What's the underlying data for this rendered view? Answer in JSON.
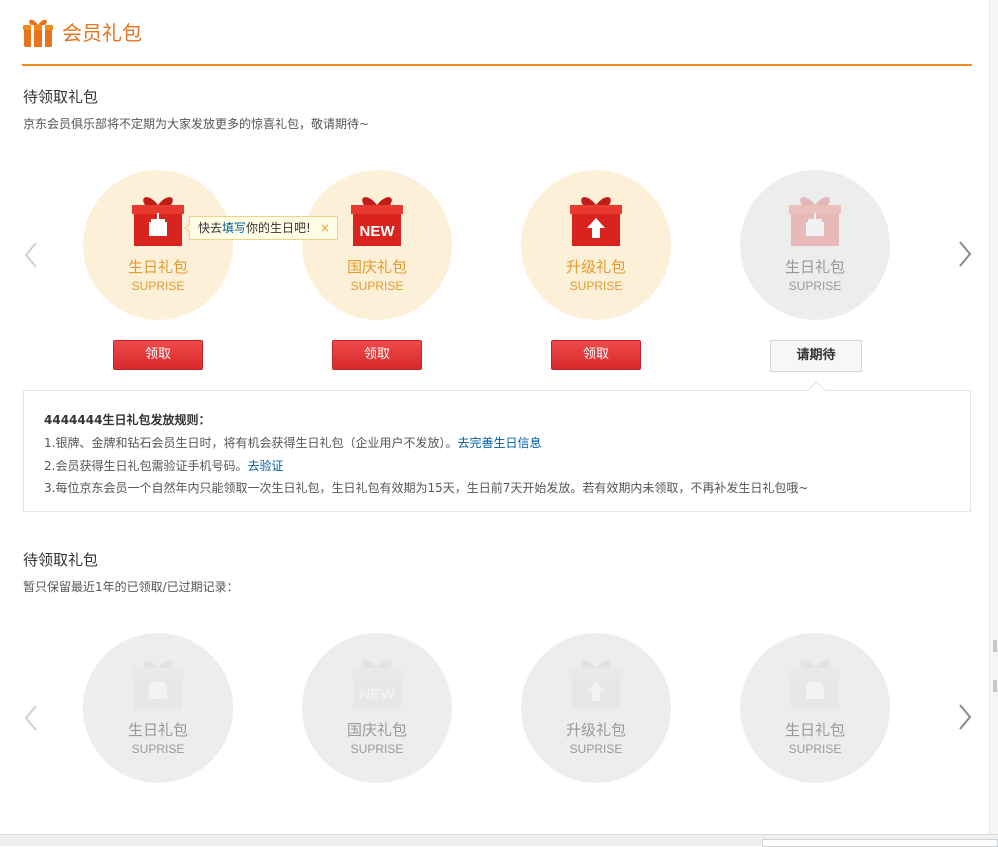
{
  "header": {
    "title": "会员礼包",
    "icon": "gift-icon"
  },
  "pending": {
    "title": "待领取礼包",
    "desc": "京东会员俱乐部将不定期为大家发放更多的惊喜礼包，敬请期待~",
    "items": [
      {
        "name": "生日礼包",
        "sub": "SUPRISE",
        "icon": "birthday-cake-gift-icon",
        "button": "领取"
      },
      {
        "name": "国庆礼包",
        "sub": "SUPRISE",
        "icon": "new-gift-icon",
        "button": "领取"
      },
      {
        "name": "升级礼包",
        "sub": "SUPRISE",
        "icon": "upgrade-arrow-gift-icon",
        "button": "领取"
      },
      {
        "name": "生日礼包",
        "sub": "SUPRISE",
        "icon": "birthday-cake-gift-icon",
        "button": "请期待"
      }
    ]
  },
  "tooltip": {
    "prefix": "快去",
    "link": "填写",
    "suffix": "你的生日吧!",
    "close": "×"
  },
  "rules": {
    "title": "4444444生日礼包发放规则：",
    "line1": "1.银牌、金牌和钻石会员生日时，将有机会获得生日礼包（企业用户不发放）。",
    "line1_link": "去完善生日信息",
    "line2": "2.会员获得生日礼包需验证手机号码。",
    "line2_link": "去验证",
    "line3": "3.每位京东会员一个自然年内只能领取一次生日礼包，生日礼包有效期为15天，生日前7天开始发放。若有效期内未领取，不再补发生日礼包哦~"
  },
  "history": {
    "title": "待领取礼包",
    "desc": "暂只保留最近1年的已领取/已过期记录：",
    "items": [
      {
        "name": "生日礼包",
        "sub": "SUPRISE"
      },
      {
        "name": "国庆礼包",
        "sub": "SUPRISE"
      },
      {
        "name": "升级礼包",
        "sub": "SUPRISE"
      },
      {
        "name": "生日礼包",
        "sub": "SUPRISE"
      }
    ]
  },
  "colors": {
    "accent": "#f08a1f",
    "button_red": "#e4393c",
    "link": "#005ea7",
    "circle_warm": "#fdf0d8",
    "circle_grey": "#ededed"
  }
}
